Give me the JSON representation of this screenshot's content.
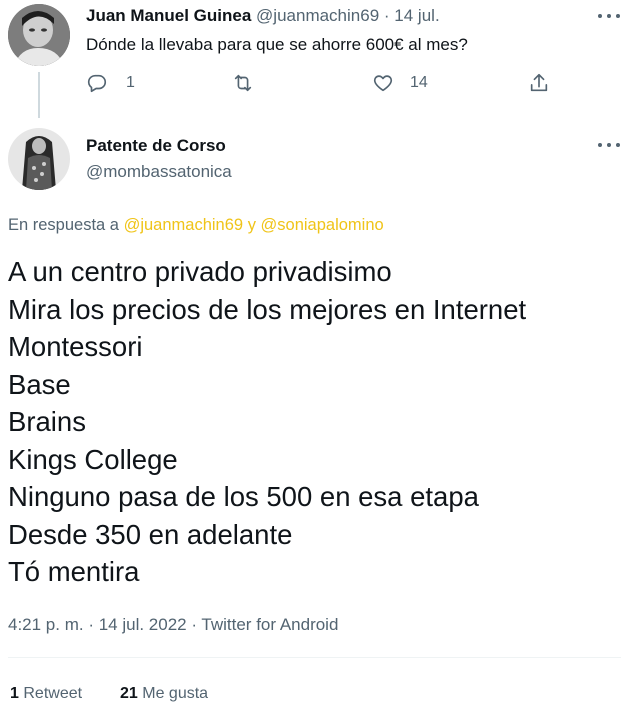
{
  "parent_tweet": {
    "author_name": "Juan Manuel Guinea",
    "handle": "@juanmachin69",
    "separator": "·",
    "date": "14 jul.",
    "text": "Dónde la llevaba para que se ahorre 600€ al mes?",
    "reply_count": "1",
    "like_count": "14"
  },
  "main_tweet": {
    "author_name": "Patente de Corso",
    "handle": "@mombassatonica",
    "replying_prefix": "En respuesta a",
    "reply_user_1": "@juanmachin69",
    "reply_conjunction": "y",
    "reply_user_2": "@soniapalomino",
    "lines": [
      "A un centro privado privadisimo",
      "Mira los precios de los mejores en Internet",
      "Montessori",
      "Base",
      "Brains",
      "Kings College",
      "Ninguno pasa de los 500 en esa etapa",
      "Desde 350 en adelante",
      "Tó mentira"
    ],
    "meta": "4:21 p. m. · 14 jul. 2022 · Twitter for Android",
    "retweets_count": "1",
    "retweets_label": "Retweet",
    "likes_count": "21",
    "likes_label": "Me gusta"
  },
  "icons": {
    "reply": "reply-icon",
    "retweet": "retweet-icon",
    "like": "heart-icon",
    "share": "share-icon",
    "more": "more-icon"
  },
  "colors": {
    "text": "#0f1419",
    "muted": "#536471",
    "mention": "#f0c419",
    "divider": "#eff3f4"
  }
}
